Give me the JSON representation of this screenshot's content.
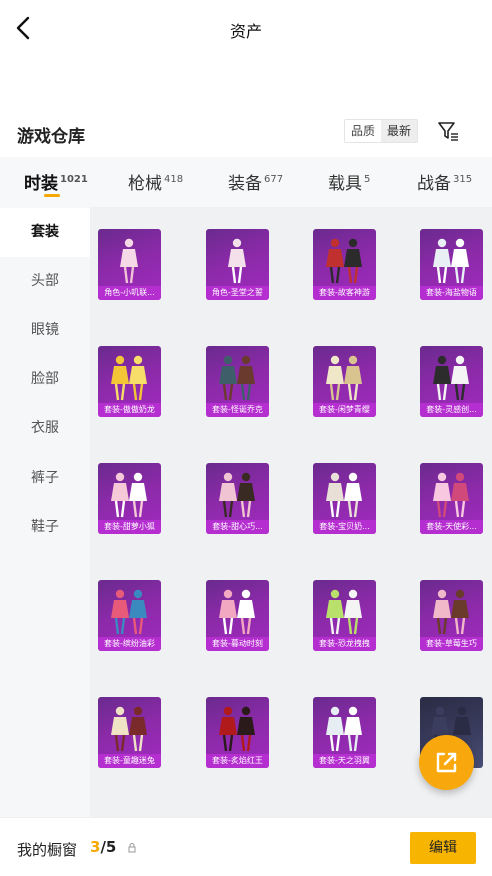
{
  "header": {
    "title": "资产"
  },
  "section": {
    "title": "游戏仓库"
  },
  "sort": {
    "options": [
      "品质",
      "最新"
    ],
    "active": 0
  },
  "tabs": [
    {
      "label": "时装",
      "count": "1021",
      "active": true
    },
    {
      "label": "枪械",
      "count": "418"
    },
    {
      "label": "装备",
      "count": "677"
    },
    {
      "label": "载具",
      "count": "5"
    },
    {
      "label": "战备",
      "count": "315"
    }
  ],
  "sidebar": {
    "items": [
      {
        "label": "套装",
        "active": true
      },
      {
        "label": "头部"
      },
      {
        "label": "眼镜"
      },
      {
        "label": "脸部"
      },
      {
        "label": "衣服"
      },
      {
        "label": "裤子"
      },
      {
        "label": "鞋子"
      }
    ]
  },
  "items": [
    "角色-小叽联...",
    "角色-圣堂之誓",
    "套装-故客神游",
    "套装-海盐物语",
    "套装-傲傲奶龙",
    "套装-怪诞乔克",
    "套装-闲梦青缨",
    "套装-灵感创...",
    "套装-甜萝小狐",
    "套装-甜心巧...",
    "套装-宝贝奶...",
    "套装-天使彩...",
    "套装-缤纷油彩",
    "套装-暮动时刻",
    "套装-恐龙拽拽",
    "套装-草莓生巧",
    "套装-童趣迷兔",
    "套装-炙焰红王",
    "套装-天之羽翼",
    ""
  ],
  "colors": {
    "accent": "#f5a800",
    "card_bg": "#8b2aa8",
    "card_label": "#b52fd0"
  },
  "icons": {
    "back": "chevron-left-icon",
    "filter": "filter-icon",
    "share": "share-icon",
    "lock": "lock-icon"
  },
  "showcase": {
    "label": "我的橱窗",
    "current": "3",
    "total": "/5"
  },
  "edit_label": "编辑"
}
